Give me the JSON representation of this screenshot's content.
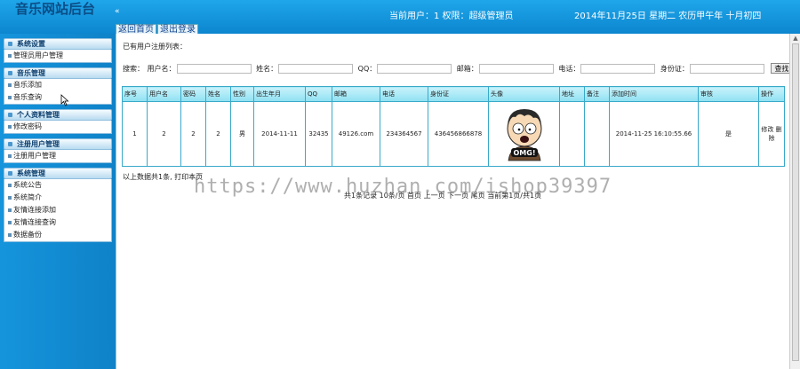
{
  "header": {
    "logo": "音乐网站后台",
    "toggle": "«",
    "user_info": "当前用户：1 权限：超级管理员",
    "date_info": "2014年11月25日  星期二  农历甲午年  十月初四",
    "tabs": [
      {
        "label": "返回首页"
      },
      {
        "label": "退出登录"
      }
    ]
  },
  "sidebar": {
    "groups": [
      {
        "title": "系统设置",
        "items": [
          {
            "label": "管理员用户管理"
          }
        ]
      },
      {
        "title": "音乐管理",
        "items": [
          {
            "label": "音乐添加"
          },
          {
            "label": "音乐查询"
          }
        ]
      },
      {
        "title": "个人资料管理",
        "items": [
          {
            "label": "修改密码"
          }
        ]
      },
      {
        "title": "注册用户管理",
        "items": [
          {
            "label": "注册用户管理"
          }
        ]
      },
      {
        "title": "系统管理",
        "items": [
          {
            "label": "系统公告"
          },
          {
            "label": "系统简介"
          },
          {
            "label": "友情连接添加"
          },
          {
            "label": "友情连接查询"
          },
          {
            "label": "数据备份"
          }
        ]
      }
    ]
  },
  "main": {
    "list_title": "已有用户注册列表：",
    "search": {
      "prefix": "搜索：",
      "fields": [
        {
          "label": "用户名："
        },
        {
          "label": "姓名："
        },
        {
          "label": "QQ："
        },
        {
          "label": "邮箱："
        },
        {
          "label": "电话："
        },
        {
          "label": "身份证："
        }
      ],
      "button": "查找"
    },
    "table": {
      "headers": [
        "序号",
        "用户名",
        "密码",
        "姓名",
        "性别",
        "出生年月",
        "QQ",
        "邮箱",
        "电话",
        "身份证",
        "头像",
        "地址",
        "备注",
        "添加时间",
        "审核",
        "操作"
      ],
      "rows": [
        {
          "index": "1",
          "username": "2",
          "password": "2",
          "name": "2",
          "gender": "男",
          "birth": "2014-11-11",
          "qq": "32435",
          "email": "49126.com",
          "phone": "234364567",
          "id_card": "436456866878",
          "avatar_caption": "OMG!",
          "address": "",
          "note": "",
          "added": "2014-11-25 16:10:55.66",
          "audit": "是",
          "actions": {
            "edit": "修改",
            "delete": "删除"
          }
        }
      ]
    },
    "summary": "以上数据共1条, 打印本页",
    "pager": "共1条记录  10条/页  首页  上一页  下一页  尾页  当前第1页/共1页",
    "watermark": "https://www.huzhan.com/ishop39397"
  },
  "colors": {
    "header": "#1fa6ea",
    "sidebar": "#1594dc",
    "table_header": "#8fe1f2",
    "table_border": "#39a9c9"
  }
}
